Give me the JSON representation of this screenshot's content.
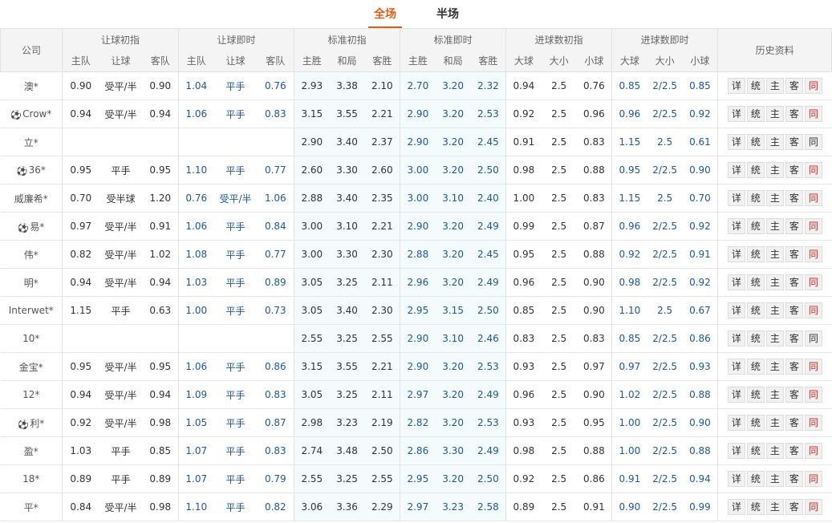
{
  "tabs": {
    "full": "全场",
    "half": "半场"
  },
  "header": {
    "company": "公司",
    "groups": [
      "让球初指",
      "让球即时",
      "标准初指",
      "标准即时",
      "进球数初指",
      "进球数即时"
    ],
    "history": "历史资料",
    "sub_ah": [
      "主队",
      "让球",
      "客队"
    ],
    "sub_1x2": [
      "主胜",
      "和局",
      "客胜"
    ],
    "sub_ou": [
      "大球",
      "大小",
      "小球"
    ]
  },
  "buttons": [
    "详",
    "统",
    "主",
    "客",
    "同"
  ],
  "rows": [
    {
      "name": "澳*",
      "icon": false,
      "c": [
        "0.90",
        "受平/半",
        "0.90",
        "1.04",
        "平手",
        "0.76",
        "2.93",
        "3.38",
        "2.10",
        "2.70",
        "3.20",
        "2.32",
        "0.94",
        "2.5",
        "0.76",
        "0.85",
        "2/2.5",
        "0.85"
      ],
      "same_red": true
    },
    {
      "name": "Crow*",
      "icon": true,
      "c": [
        "0.94",
        "受平/半",
        "0.94",
        "1.06",
        "平手",
        "0.83",
        "3.15",
        "3.55",
        "2.21",
        "2.90",
        "3.20",
        "2.53",
        "0.92",
        "2.5",
        "0.96",
        "0.96",
        "2/2.5",
        "0.92"
      ],
      "same_red": true
    },
    {
      "name": "立*",
      "icon": false,
      "c": [
        "",
        "",
        "",
        "",
        "",
        "",
        "2.90",
        "3.40",
        "2.37",
        "2.90",
        "3.20",
        "2.45",
        "0.91",
        "2.5",
        "0.83",
        "1.15",
        "2.5",
        "0.61"
      ],
      "same_red": false
    },
    {
      "name": "36*",
      "icon": true,
      "c": [
        "0.95",
        "平手",
        "0.95",
        "1.10",
        "平手",
        "0.77",
        "2.60",
        "3.30",
        "2.60",
        "3.00",
        "3.20",
        "2.50",
        "0.98",
        "2.5",
        "0.88",
        "0.95",
        "2/2.5",
        "0.90"
      ],
      "same_red": true
    },
    {
      "name": "威廉希*",
      "icon": false,
      "c": [
        "0.70",
        "受半球",
        "1.20",
        "0.76",
        "受平/半",
        "1.06",
        "2.88",
        "3.40",
        "2.35",
        "3.00",
        "3.10",
        "2.40",
        "1.00",
        "2.5",
        "0.83",
        "1.15",
        "2.5",
        "0.70"
      ],
      "same_red": true
    },
    {
      "name": "易*",
      "icon": true,
      "c": [
        "0.97",
        "受平/半",
        "0.91",
        "1.06",
        "平手",
        "0.84",
        "3.00",
        "3.10",
        "2.21",
        "2.90",
        "3.20",
        "2.49",
        "0.99",
        "2.5",
        "0.87",
        "0.96",
        "2/2.5",
        "0.92"
      ],
      "same_red": true
    },
    {
      "name": "伟*",
      "icon": false,
      "c": [
        "0.82",
        "受平/半",
        "1.02",
        "1.08",
        "平手",
        "0.77",
        "3.00",
        "3.30",
        "2.30",
        "2.88",
        "3.20",
        "2.45",
        "0.95",
        "2.5",
        "0.88",
        "0.92",
        "2/2.5",
        "0.91"
      ],
      "same_red": true
    },
    {
      "name": "明*",
      "icon": false,
      "c": [
        "0.94",
        "受平/半",
        "0.94",
        "1.03",
        "平手",
        "0.89",
        "3.05",
        "3.25",
        "2.11",
        "2.96",
        "3.20",
        "2.49",
        "0.96",
        "2.5",
        "0.90",
        "0.98",
        "2/2.5",
        "0.92"
      ],
      "same_red": true
    },
    {
      "name": "Interwet*",
      "icon": false,
      "c": [
        "1.15",
        "平手",
        "0.63",
        "1.00",
        "平手",
        "0.73",
        "3.05",
        "3.40",
        "2.30",
        "2.95",
        "3.15",
        "2.50",
        "0.85",
        "2.5",
        "0.90",
        "1.10",
        "2.5",
        "0.67"
      ],
      "same_red": true
    },
    {
      "name": "10*",
      "icon": false,
      "c": [
        "",
        "",
        "",
        "",
        "",
        "",
        "2.55",
        "3.25",
        "2.55",
        "2.90",
        "3.10",
        "2.46",
        "0.83",
        "2.5",
        "0.83",
        "0.85",
        "2/2.5",
        "0.86"
      ],
      "same_red": false
    },
    {
      "name": "金宝*",
      "icon": false,
      "c": [
        "0.95",
        "受平/半",
        "0.95",
        "1.06",
        "平手",
        "0.86",
        "3.15",
        "3.55",
        "2.21",
        "2.90",
        "3.20",
        "2.53",
        "0.93",
        "2.5",
        "0.97",
        "0.97",
        "2/2.5",
        "0.93"
      ],
      "same_red": true
    },
    {
      "name": "12*",
      "icon": false,
      "c": [
        "0.94",
        "受平/半",
        "0.94",
        "1.09",
        "平手",
        "0.83",
        "3.05",
        "3.25",
        "2.11",
        "2.97",
        "3.20",
        "2.49",
        "0.96",
        "2.5",
        "0.90",
        "1.02",
        "2/2.5",
        "0.88"
      ],
      "same_red": true
    },
    {
      "name": "利*",
      "icon": true,
      "c": [
        "0.92",
        "受平/半",
        "0.98",
        "1.05",
        "平手",
        "0.87",
        "2.98",
        "3.23",
        "2.19",
        "2.82",
        "3.20",
        "2.53",
        "0.93",
        "2.5",
        "0.95",
        "1.00",
        "2/2.5",
        "0.90"
      ],
      "same_red": true
    },
    {
      "name": "盈*",
      "icon": false,
      "c": [
        "1.03",
        "平手",
        "0.85",
        "1.07",
        "平手",
        "0.83",
        "2.74",
        "3.48",
        "2.50",
        "2.86",
        "3.30",
        "2.49",
        "0.98",
        "2.5",
        "0.88",
        "1.00",
        "2/2.5",
        "0.88"
      ],
      "same_red": true
    },
    {
      "name": "18*",
      "icon": false,
      "c": [
        "0.89",
        "平手",
        "0.89",
        "1.07",
        "平手",
        "0.79",
        "2.55",
        "3.25",
        "2.55",
        "2.95",
        "3.20",
        "2.50",
        "0.92",
        "2.5",
        "0.86",
        "0.91",
        "2/2.5",
        "0.94"
      ],
      "same_red": true
    },
    {
      "name": "平*",
      "icon": false,
      "c": [
        "0.84",
        "受平/半",
        "0.98",
        "1.10",
        "平手",
        "0.82",
        "3.06",
        "3.36",
        "2.29",
        "2.97",
        "3.23",
        "2.58",
        "0.89",
        "2.5",
        "0.91",
        "0.90",
        "2/2.5",
        "0.99"
      ],
      "same_red": true
    }
  ]
}
